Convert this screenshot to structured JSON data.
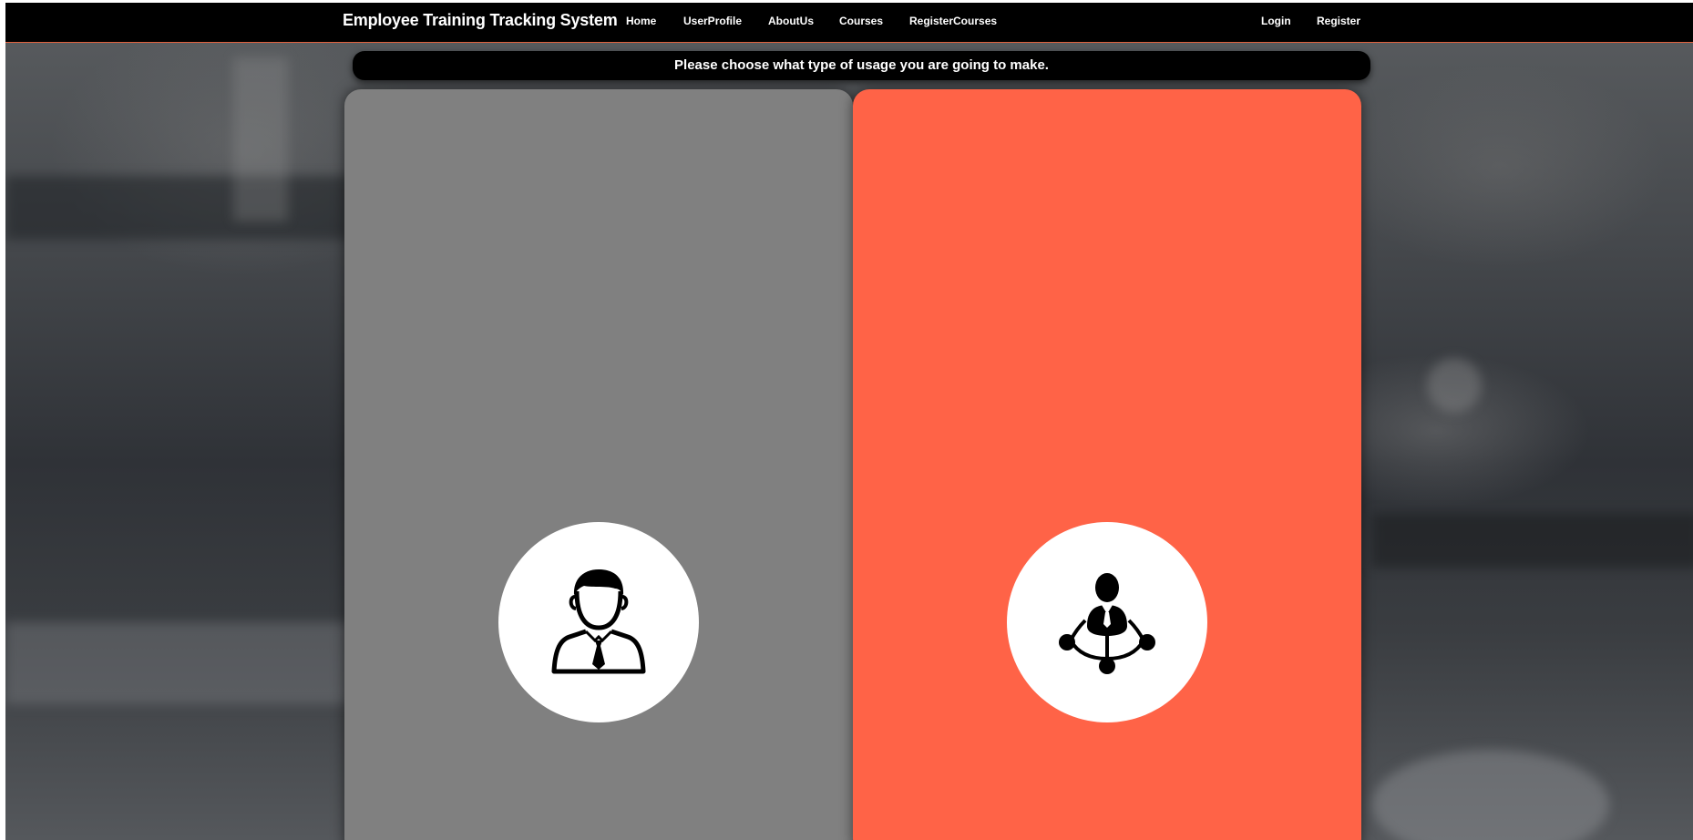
{
  "navbar": {
    "brand": "Employee Training Tracking System",
    "links": {
      "home": "Home",
      "user_profile": "UserProfile",
      "about_us": "AboutUs",
      "courses": "Courses",
      "register_courses": "RegisterCourses",
      "login": "Login",
      "register": "Register"
    },
    "border_color": "#e0623f"
  },
  "banner": {
    "text": "Please choose what type of usage you are going to make."
  },
  "cards": {
    "employee": {
      "icon": "employee-person-icon",
      "color": "#808080"
    },
    "manager": {
      "icon": "manager-network-icon",
      "color": "#ff6347"
    }
  }
}
